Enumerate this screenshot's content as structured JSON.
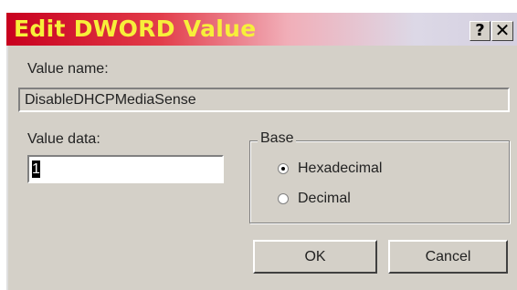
{
  "window": {
    "title": "Edit DWORD Value",
    "help_glyph": "?",
    "close_glyph": "✕"
  },
  "value_name": {
    "label": "Value name:",
    "value": "DisableDHCPMediaSense"
  },
  "value_data": {
    "label": "Value data:",
    "value": "1"
  },
  "base": {
    "label": "Base",
    "options": [
      {
        "label": "Hexadecimal",
        "selected": true
      },
      {
        "label": "Decimal",
        "selected": false
      }
    ]
  },
  "buttons": {
    "ok": "OK",
    "cancel": "Cancel"
  },
  "colors": {
    "title_text": "#f7ef3a",
    "title_bar_start": "#c8001e",
    "dialog_face": "#d4d0c8"
  }
}
